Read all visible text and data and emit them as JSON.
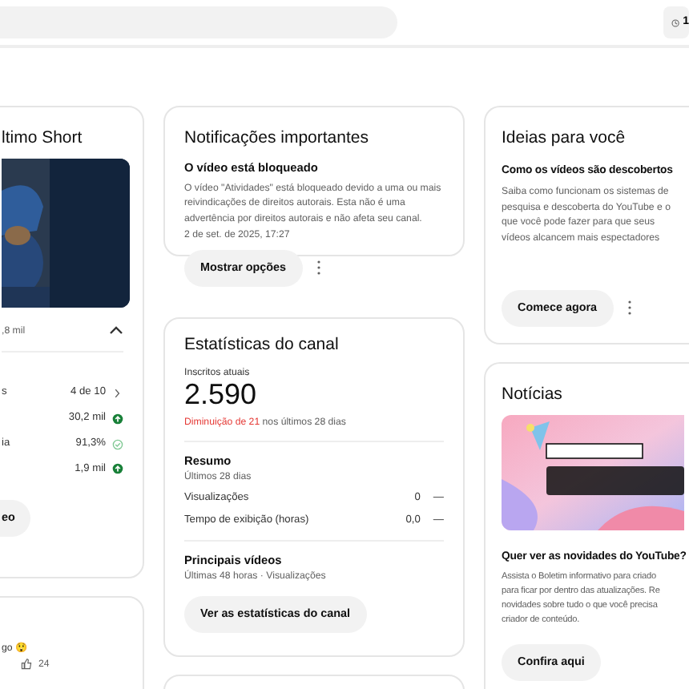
{
  "top_bar": {
    "history_button": "1"
  },
  "last_short": {
    "title": "ltimo Short",
    "views": ",8 mil",
    "expanded": true,
    "metrics": [
      {
        "label": "s",
        "value": "4 de 10",
        "kind": "link"
      },
      {
        "value": "30,2 mil",
        "kind": "up"
      },
      {
        "label": "ia",
        "value": "91,3%",
        "kind": "ok"
      },
      {
        "value": "1,9 mil",
        "kind": "up"
      }
    ],
    "button": "eo"
  },
  "comment": {
    "text": "go 😲",
    "likes": "24"
  },
  "notifications": {
    "title": "Notificações importantes",
    "heading": "O vídeo está bloqueado",
    "body": "O vídeo \"Atividades\" está bloqueado devido a uma ou mais reivindicações de direitos autorais. Esta não é uma advertência por direitos autorais e não afeta seu canal.",
    "date": "2 de set. de 2025, 17:27",
    "button": "Mostrar opções"
  },
  "channel_stats": {
    "title": "Estatísticas do canal",
    "subscribers_label": "Inscritos atuais",
    "subscribers": "2.590",
    "change": "Diminuição de 21",
    "change_suffix": "nos últimos 28 dias",
    "summary": {
      "title": "Resumo",
      "period": "Últimos 28 dias",
      "rows": [
        {
          "label": "Visualizações",
          "value": "0",
          "trend": "—"
        },
        {
          "label": "Tempo de exibição (horas)",
          "value": "0,0",
          "trend": "—"
        }
      ]
    },
    "top_videos": {
      "title": "Principais vídeos",
      "period": "Últimas 48 horas · Visualizações"
    },
    "button": "Ver as estatísticas do canal"
  },
  "ideas": {
    "title": "Ideias para você",
    "heading": "Como os vídeos são descobertos",
    "body": "Saiba como funcionam os sistemas de pesquisa e descoberta do YouTube e o que você pode fazer para que seus vídeos alcancem mais espectadores",
    "button": "Comece agora"
  },
  "news": {
    "title": "Notícias",
    "heading": "Quer ver as novidades do YouTube?",
    "body_lines": [
      "Assista o Boletim informativo para criado",
      "para ficar por dentro das atualizações. Re",
      "novidades sobre tudo o que você precisa",
      "criador de conteúdo."
    ],
    "button": "Confira aqui"
  }
}
